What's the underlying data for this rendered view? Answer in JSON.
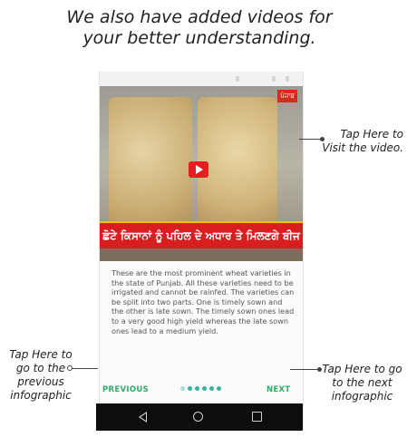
{
  "headline": "We also have added videos for your better understanding.",
  "video": {
    "overlay_text": "ਛੋਟੇ ਕਿਸਾਨਾਂ ਨੂੰ ਪਹਿਲ ਦੇ ਅਧਾਰ ਤੇ ਮਿਲਣਗੇ ਬੀਜ",
    "channel_badge": "ਪੰਜਾਬ",
    "play_icon": "play-icon"
  },
  "description": "These are the most prominent wheat varieties in the state of Punjab. All these varieties need to be irrigated and cannot be rainfed. The varieties can be split into two parts. One is timely sown and the other is late sown. The timely sown ones lead to a very good high yield whereas the late sown ones lead to a medium yield.",
  "navigation": {
    "previous_label": "PREVIOUS",
    "next_label": "NEXT",
    "page_count": 6,
    "current_page": 1
  },
  "system_nav": {
    "back_icon": "back-icon",
    "home_icon": "home-icon",
    "recent_icon": "recent-apps-icon"
  },
  "callouts": {
    "video": "Tap Here to Visit the video.",
    "previous": "Tap Here to go to the previous infographic",
    "next": "Tap Here to go to the next infographic"
  },
  "colors": {
    "accent_green": "#33a86b",
    "dot_active": "#33b4a0",
    "ticker_red": "#d81e1e"
  }
}
